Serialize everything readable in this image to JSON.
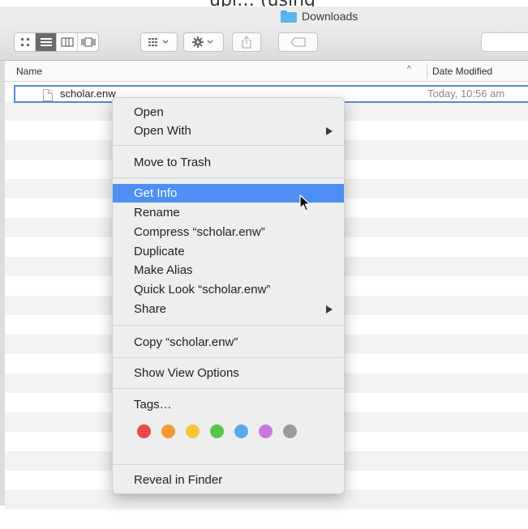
{
  "window": {
    "title": "Downloads",
    "caption_fragment": "upl…            (using"
  },
  "toolbar": {
    "view_buttons": [
      {
        "name": "icon-view-button",
        "icon": "icon-view-icon"
      },
      {
        "name": "list-view-button",
        "icon": "list-view-icon",
        "active": true
      },
      {
        "name": "column-view-button",
        "icon": "column-view-icon"
      },
      {
        "name": "cover-flow-button",
        "icon": "cover-flow-icon"
      }
    ],
    "arrange_icon": "arrange-grid-icon",
    "action_icon": "gear-icon",
    "share_icon": "share-icon",
    "tag_icon": "tag-icon"
  },
  "columns": {
    "name": "Name",
    "sort_indicator": "^",
    "date": "Date Modified"
  },
  "file": {
    "name": "scholar.enw",
    "date": "Today, 10:56 am"
  },
  "context_menu": {
    "open": "Open",
    "open_with": "Open With",
    "move_to_trash": "Move to Trash",
    "get_info": "Get Info",
    "rename": "Rename",
    "compress": "Compress “scholar.enw”",
    "duplicate": "Duplicate",
    "make_alias": "Make Alias",
    "quick_look": "Quick Look “scholar.enw”",
    "share": "Share",
    "copy": "Copy “scholar.enw”",
    "show_view_options": "Show View Options",
    "tags": "Tags…",
    "reveal_in_finder": "Reveal in Finder",
    "highlighted_item": "Get Info"
  },
  "tag_colors": [
    "#e8494a",
    "#f09a37",
    "#f5c731",
    "#5ac54c",
    "#5ca9ec",
    "#c77be0",
    "#9a9a9a"
  ],
  "colors": {
    "selection": "#4d8ff2",
    "file_outline": "#5a88cf",
    "folder": "#5bb4ee"
  }
}
